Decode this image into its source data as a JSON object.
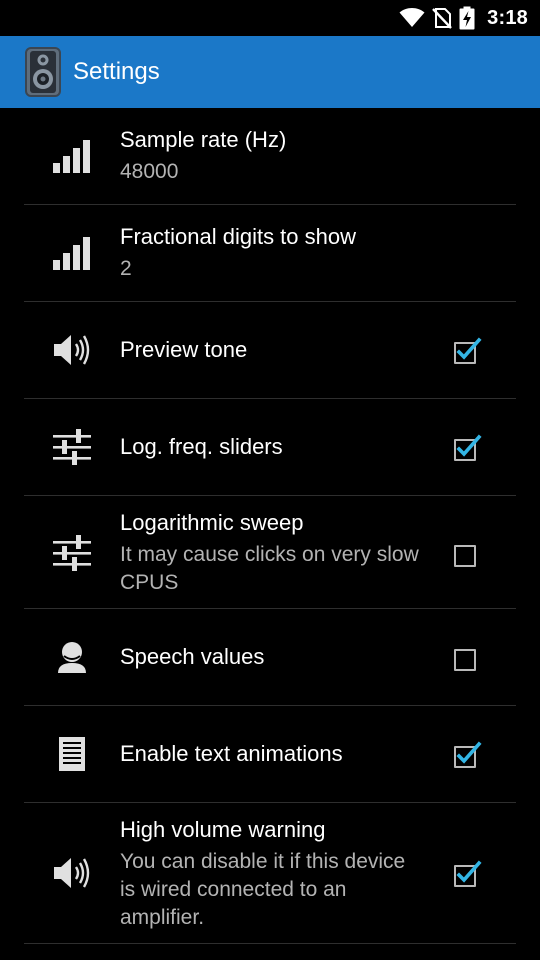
{
  "status_bar": {
    "time": "3:18",
    "icons": [
      "wifi-icon",
      "no-sim-icon",
      "battery-charging-icon"
    ]
  },
  "app_bar": {
    "title": "Settings",
    "icon": "speaker-app-icon",
    "color": "#1b78c8"
  },
  "settings": [
    {
      "title": "Sample rate (Hz)",
      "summary": "48000",
      "icon": "signal-bars-icon"
    },
    {
      "title": "Fractional digits to show",
      "summary": "2",
      "icon": "signal-bars-icon"
    },
    {
      "title": "Preview tone",
      "icon": "speaker-volume-icon",
      "checked": true
    },
    {
      "title": "Log. freq. sliders",
      "icon": "sliders-icon",
      "checked": true
    },
    {
      "title": "Logarithmic sweep",
      "summary": "It may cause clicks on very slow CPUS",
      "icon": "sliders-icon",
      "checked": false
    },
    {
      "title": "Speech values",
      "icon": "person-icon",
      "checked": false
    },
    {
      "title": "Enable text animations",
      "icon": "document-icon",
      "checked": true
    },
    {
      "title": "High volume warning",
      "summary": "You can disable it if this device is wired connected to an amplifier.",
      "icon": "speaker-volume-icon",
      "checked": true
    }
  ],
  "colors": {
    "check_accent": "#33b5e5",
    "summary_text": "#b3b3b3"
  }
}
